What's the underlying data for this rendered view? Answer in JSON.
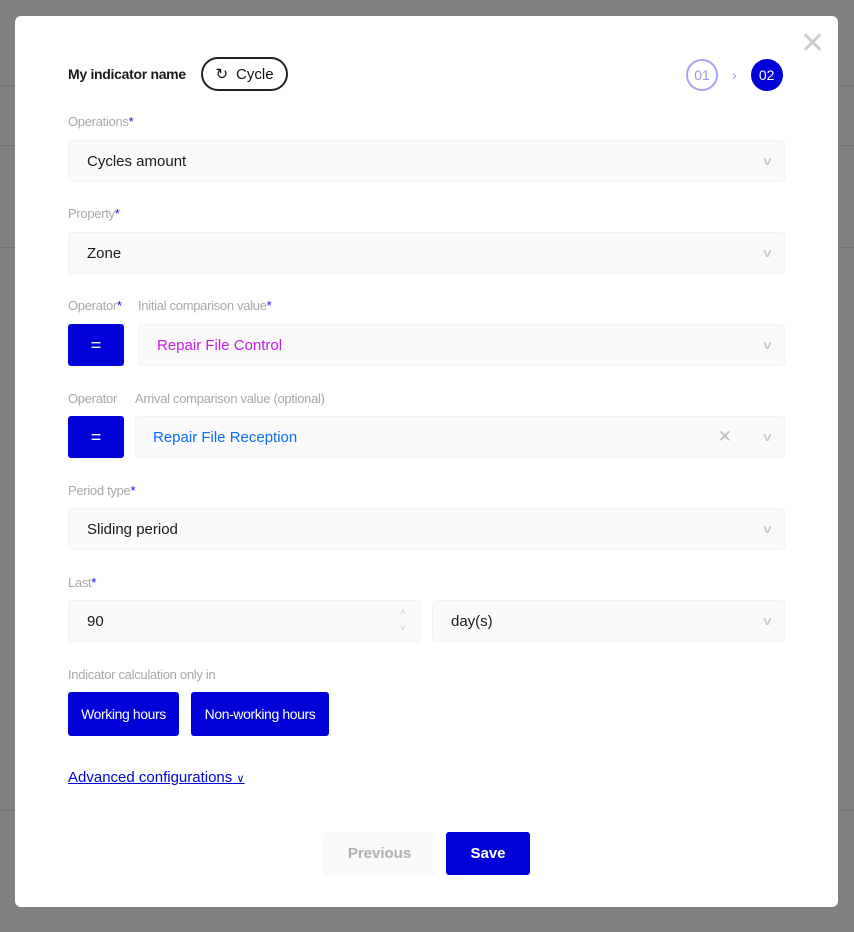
{
  "modal": {
    "title": "My indicator name",
    "type_chip": {
      "icon": "refresh-icon",
      "label": "Cycle"
    },
    "steps": [
      {
        "label": "01",
        "state": "done"
      },
      {
        "label": "02",
        "state": "active"
      }
    ],
    "close_icon": "close-icon",
    "operations": {
      "label": "Operations",
      "required": "*",
      "value": "Cycles amount"
    },
    "property": {
      "label": "Property",
      "required": "*",
      "value": "Zone"
    },
    "initial": {
      "operator_label": "Operator",
      "operator_required": "*",
      "operator_value": "=",
      "label": "Initial comparison value",
      "required": "*",
      "value": "Repair File Control",
      "value_color": "#c41ee6"
    },
    "arrival": {
      "operator_label": "Operator",
      "operator_value": "=",
      "label": "Arrival comparison value (optional)",
      "value": "Repair File Reception",
      "value_color": "#0a6cf0"
    },
    "period_type": {
      "label": "Period type",
      "required": "*",
      "value": "Sliding period"
    },
    "last": {
      "label": "Last",
      "required": "*",
      "value": "90",
      "unit": "day(s)"
    },
    "calc": {
      "label": "Indicator calculation only in",
      "options": [
        "Working hours",
        "Non-working hours"
      ]
    },
    "advanced_link": "Advanced configurations",
    "previous_label": "Previous",
    "save_label": "Save"
  },
  "colors": {
    "accent": "#0000d8"
  }
}
